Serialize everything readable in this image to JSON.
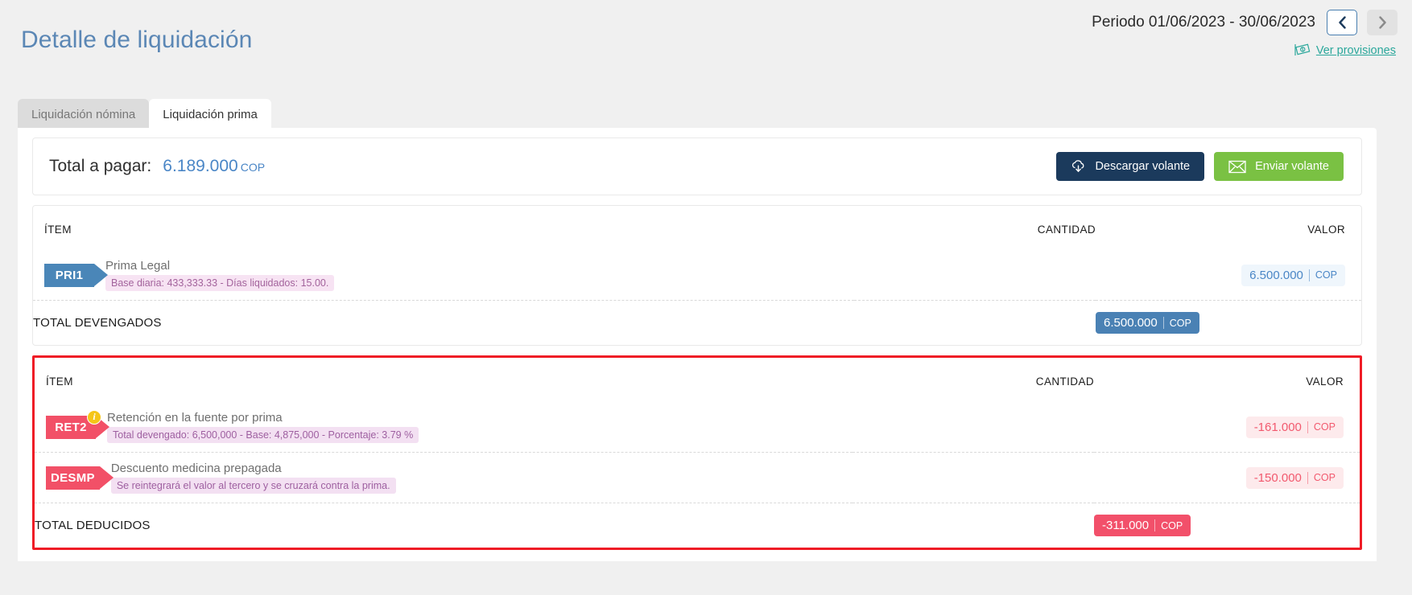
{
  "header": {
    "title": "Detalle de liquidación",
    "period_text": "Periodo 01/06/2023 - 30/06/2023",
    "prev_label": "‹",
    "next_label": "›",
    "provisiones_link": "Ver provisiones",
    "provisiones_icon": "money-bill-icon",
    "accent_color": "#5b87b5",
    "link_color": "#2aa79b"
  },
  "tabs": [
    {
      "label": "Liquidación nómina",
      "active": false
    },
    {
      "label": "Liquidación prima",
      "active": true
    }
  ],
  "summary": {
    "label": "Total a pagar:",
    "amount": "6.189.000",
    "currency": "COP",
    "download_button": "Descargar volante",
    "download_icon": "cloud-download-icon",
    "send_button": "Enviar volante",
    "send_icon": "envelope-icon",
    "download_color": "#1b3a5c",
    "send_color": "#7ac143"
  },
  "earnings": {
    "columns": {
      "item": "ÍTEM",
      "quantity": "CANTIDAD",
      "value": "VALOR"
    },
    "rows": [
      {
        "code": "PRI1",
        "code_color": "#4a86b8",
        "title": "Prima Legal",
        "note": "Base diaria: 433,333.33 - Días liquidados: 15.00.",
        "quantity": "",
        "value": "6.500.000",
        "currency": "COP"
      }
    ],
    "total": {
      "label": "TOTAL DEVENGADOS",
      "value": "6.500.000",
      "currency": "COP"
    }
  },
  "deductions": {
    "columns": {
      "item": "ÍTEM",
      "quantity": "CANTIDAD",
      "value": "VALOR"
    },
    "highlight_color": "#ef1c26",
    "rows": [
      {
        "code": "RET2",
        "code_color": "#f25067",
        "badge_icon": "info-icon",
        "badge_icon_char": "i",
        "title": "Retención en la fuente por prima",
        "note": "Total devengado: 6,500,000 - Base: 4,875,000 - Porcentaje: 3.79 %",
        "quantity": "",
        "value": "-161.000",
        "currency": "COP"
      },
      {
        "code": "DESMP",
        "code_color": "#f25067",
        "title": "Descuento medicina prepagada",
        "note": "Se reintegrará el valor al tercero y se cruzará contra la prima.",
        "quantity": "",
        "value": "-150.000",
        "currency": "COP"
      }
    ],
    "total": {
      "label": "TOTAL DEDUCIDOS",
      "value": "-311.000",
      "currency": "COP"
    }
  }
}
